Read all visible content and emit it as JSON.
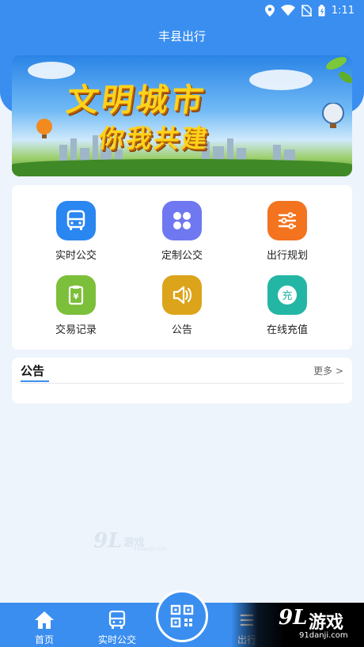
{
  "status_bar": {
    "time": "1:11",
    "icons": [
      "location-icon",
      "wifi-icon",
      "no-sim-icon",
      "battery-icon"
    ]
  },
  "header": {
    "title": "丰县出行"
  },
  "banner": {
    "line1": "文明城市",
    "line2": "你我共建"
  },
  "grid": {
    "items": [
      {
        "label": "实时公交",
        "icon": "bus-icon",
        "color": "#2a86f0"
      },
      {
        "label": "定制公交",
        "icon": "four-petal-icon",
        "color": "#6f78f0"
      },
      {
        "label": "出行规划",
        "icon": "sliders-icon",
        "color": "#f3731f"
      },
      {
        "label": "交易记录",
        "icon": "receipt-icon",
        "color": "#7cbf3a"
      },
      {
        "label": "公告",
        "icon": "speaker-icon",
        "color": "#dca41a"
      },
      {
        "label": "在线充值",
        "icon": "recharge-icon",
        "color": "#24b6a4",
        "badge": "充"
      }
    ]
  },
  "notice": {
    "title": "公告",
    "more": "更多 >"
  },
  "watermark": {
    "logo": "9L",
    "name": "游戏",
    "url": "91danji.com"
  },
  "tabbar": {
    "tabs": [
      {
        "label": "首页",
        "icon": "home-icon"
      },
      {
        "label": "实时公交",
        "icon": "bus-icon"
      },
      {
        "label": "出行",
        "icon": "route-icon"
      }
    ],
    "center_icon": "qr-code-icon"
  },
  "corner_watermark": {
    "logo": "9L",
    "name": "游戏",
    "url": "91danji.com"
  },
  "colors": {
    "primary": "#3a8ef0",
    "background": "#eef4fb"
  }
}
